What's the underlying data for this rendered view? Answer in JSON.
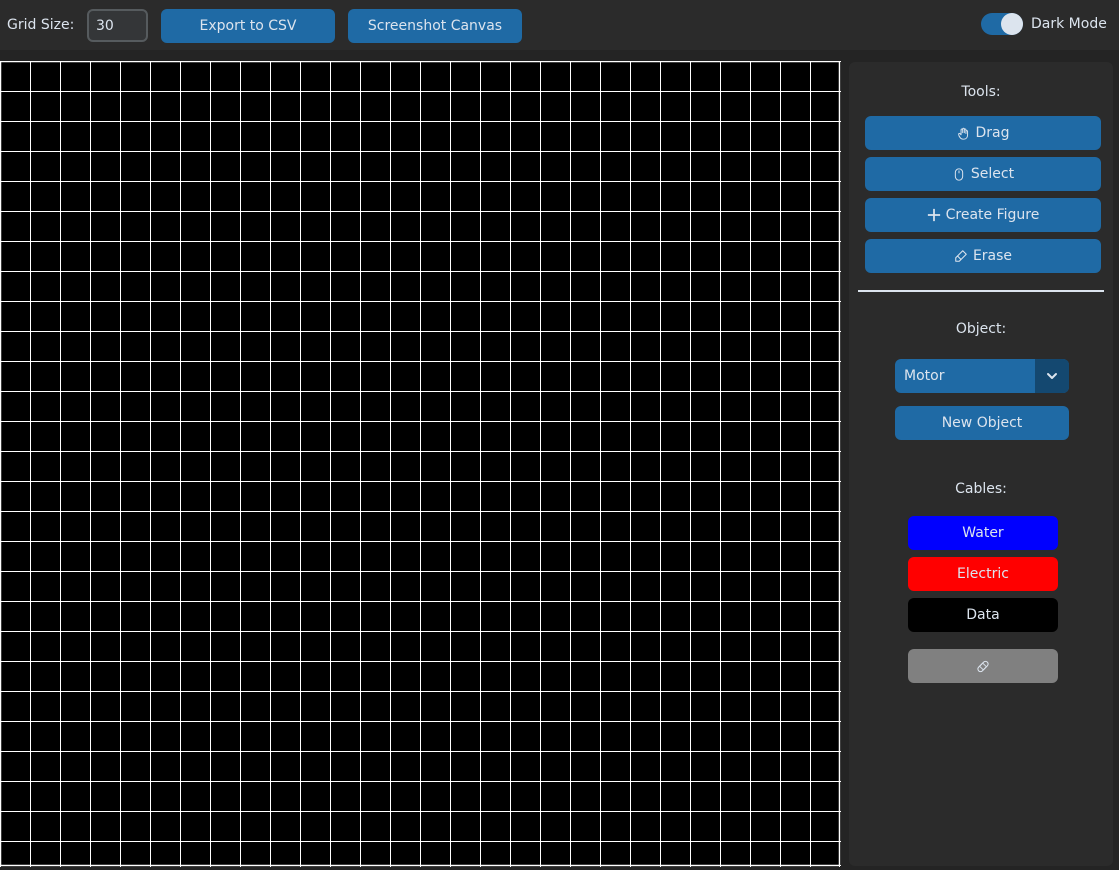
{
  "toolbar": {
    "grid_size_label": "Grid Size:",
    "grid_size_value": "30",
    "export_label": "Export to CSV",
    "screenshot_label": "Screenshot Canvas",
    "dark_mode_label": "Dark Mode",
    "dark_mode_on": true
  },
  "canvas": {
    "columns": 28,
    "rows": 27,
    "background": "#000000",
    "grid_line_color": "#ffffff"
  },
  "panel": {
    "tools_label": "Tools:",
    "tools": [
      {
        "label": "Drag",
        "icon": "hand-icon"
      },
      {
        "label": "Select",
        "icon": "mouse-icon"
      },
      {
        "label": "Create Figure",
        "icon": "plus-icon"
      },
      {
        "label": "Erase",
        "icon": "eraser-icon"
      }
    ],
    "object_label": "Object:",
    "object_selected": "Motor",
    "new_object_label": "New Object",
    "cables_label": "Cables:",
    "cables": [
      {
        "label": "Water",
        "color": "#0000ff"
      },
      {
        "label": "Electric",
        "color": "#ff0000"
      },
      {
        "label": "Data",
        "color": "#000000"
      }
    ],
    "cable_extra_icon": "bandage-icon"
  },
  "colors": {
    "accent": "#1f6aa5",
    "panel_bg": "#2b2b2b",
    "window_bg": "#242424",
    "text": "#dce4ee"
  }
}
